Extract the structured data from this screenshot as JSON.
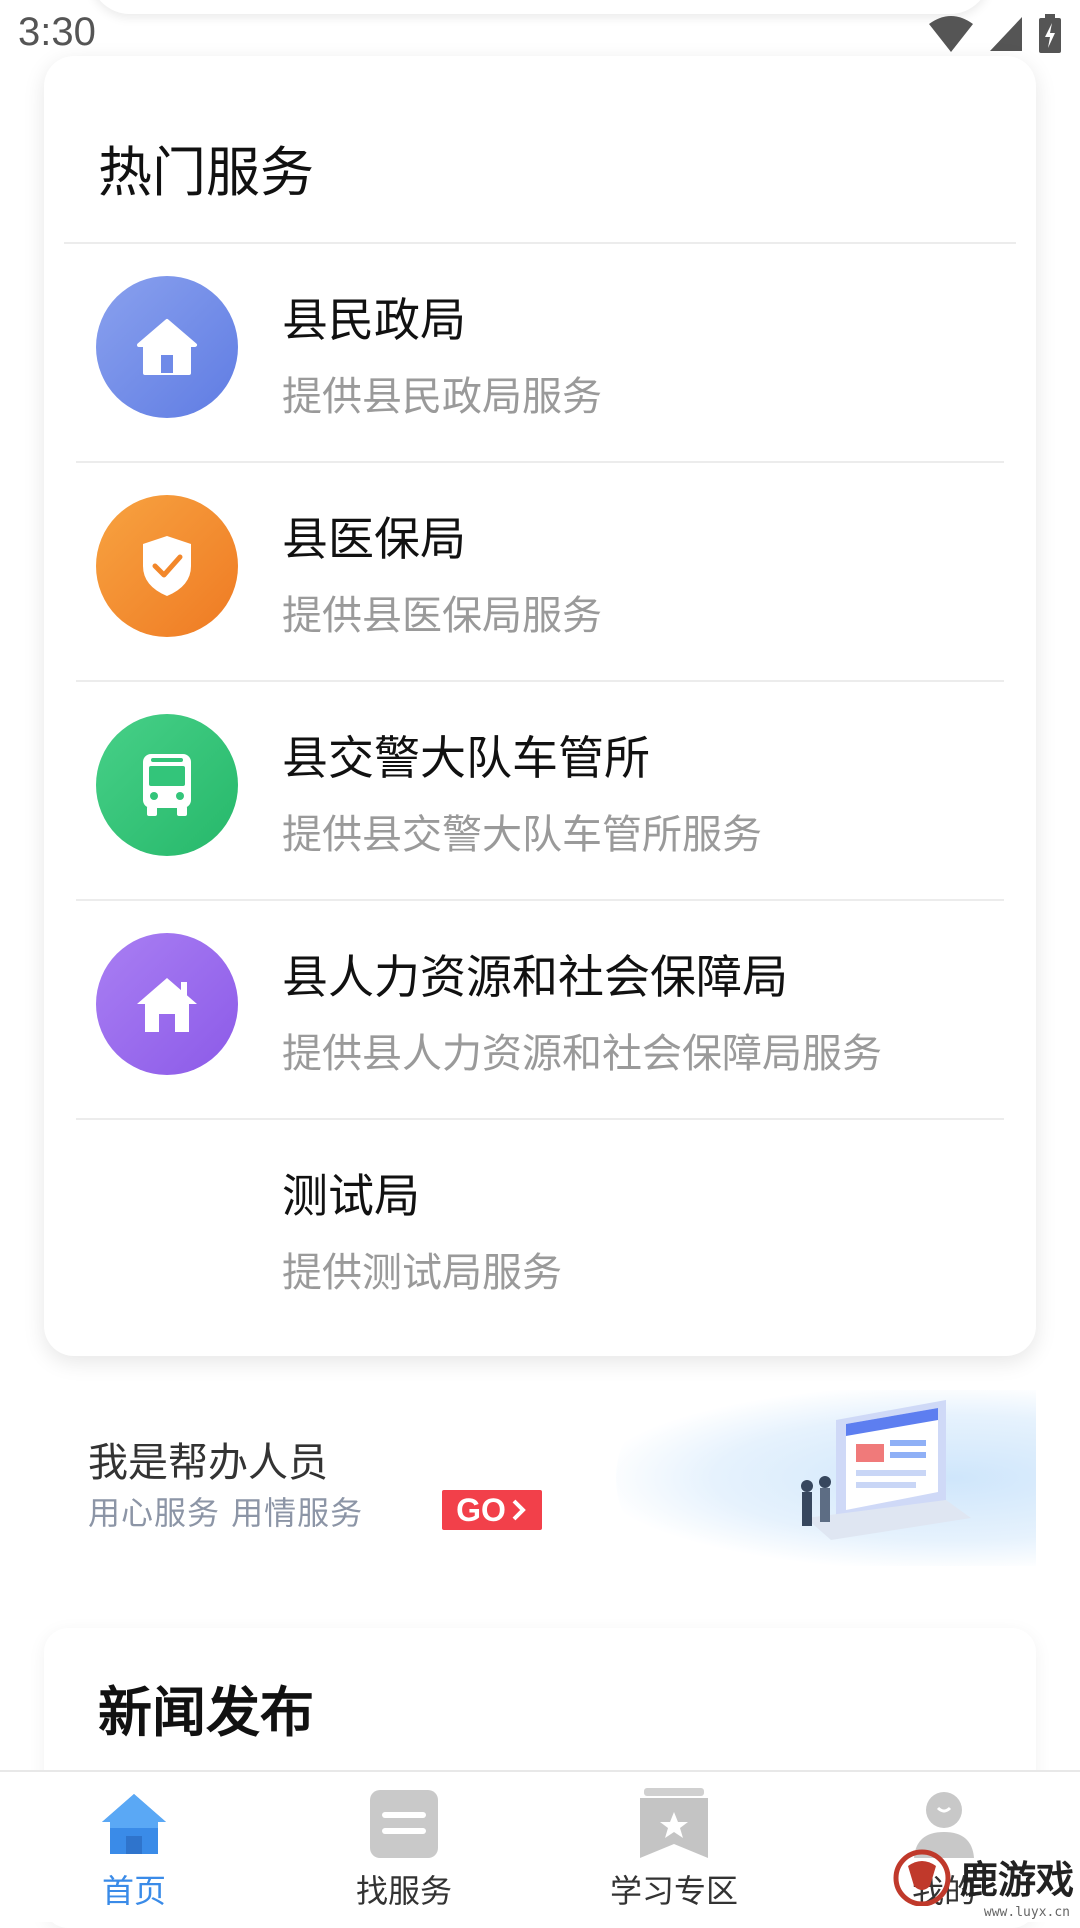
{
  "status_bar": {
    "time": "3:30"
  },
  "hot_services": {
    "title": "热门服务",
    "items": [
      {
        "name": "县民政局",
        "desc": "提供县民政局服务",
        "icon": "home-icon",
        "color": "#6f8ae8"
      },
      {
        "name": "县医保局",
        "desc": "提供县医保局服务",
        "icon": "shield-check-icon",
        "color": "#f2872a"
      },
      {
        "name": "县交警大队车管所",
        "desc": "提供县交警大队车管所服务",
        "icon": "bus-icon",
        "color": "#33c57a"
      },
      {
        "name": "县人力资源和社会保障局",
        "desc": "提供县人力资源和社会保障局服务",
        "icon": "house-icon",
        "color": "#9b6df0"
      },
      {
        "name": "测试局",
        "desc": "提供测试局服务",
        "icon": "",
        "color": ""
      }
    ]
  },
  "banner": {
    "title": "我是帮办人员",
    "subtitle": "用心服务  用情服务",
    "go_label": "GO",
    "icon": "laptop-handshake-illustration"
  },
  "news": {
    "title": "新闻发布"
  },
  "bottom_nav": {
    "items": [
      {
        "label": "首页",
        "icon": "home-tab-icon",
        "active": true
      },
      {
        "label": "找服务",
        "icon": "list-tab-icon",
        "active": false
      },
      {
        "label": "学习专区",
        "icon": "bookmark-tab-icon",
        "active": false
      },
      {
        "label": "我的",
        "icon": "user-tab-icon",
        "active": false
      }
    ]
  },
  "watermark": {
    "text": "鹿游戏",
    "url_text": "www.luyx.cn"
  }
}
